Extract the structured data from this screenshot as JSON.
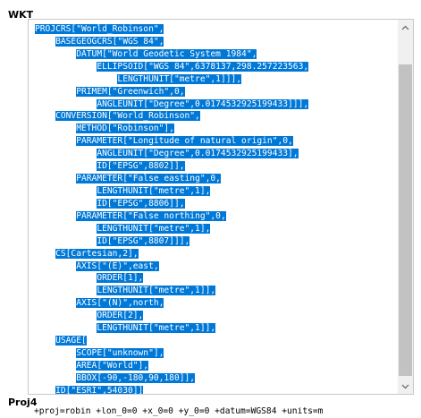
{
  "sections": {
    "wkt_label": "WKT",
    "proj4_label": "Proj4"
  },
  "wkt": {
    "lines": [
      {
        "indent": "",
        "text": "PROJCRS[\"World_Robinson\","
      },
      {
        "indent": "    ",
        "text": "BASEGEOGCRS[\"WGS 84\","
      },
      {
        "indent": "        ",
        "text": "DATUM[\"World Geodetic System 1984\","
      },
      {
        "indent": "            ",
        "text": "ELLIPSOID[\"WGS 84\",6378137,298.257223563,"
      },
      {
        "indent": "                ",
        "text": "LENGTHUNIT[\"metre\",1]]],"
      },
      {
        "indent": "        ",
        "text": "PRIMEM[\"Greenwich\",0,"
      },
      {
        "indent": "            ",
        "text": "ANGLEUNIT[\"Degree\",0.0174532925199433]]],"
      },
      {
        "indent": "    ",
        "text": "CONVERSION[\"World_Robinson\","
      },
      {
        "indent": "        ",
        "text": "METHOD[\"Robinson\"],"
      },
      {
        "indent": "        ",
        "text": "PARAMETER[\"Longitude of natural origin\",0,"
      },
      {
        "indent": "            ",
        "text": "ANGLEUNIT[\"Degree\",0.0174532925199433],"
      },
      {
        "indent": "            ",
        "text": "ID[\"EPSG\",8802]],"
      },
      {
        "indent": "        ",
        "text": "PARAMETER[\"False easting\",0,"
      },
      {
        "indent": "            ",
        "text": "LENGTHUNIT[\"metre\",1],"
      },
      {
        "indent": "            ",
        "text": "ID[\"EPSG\",8806]],"
      },
      {
        "indent": "        ",
        "text": "PARAMETER[\"False northing\",0,"
      },
      {
        "indent": "            ",
        "text": "LENGTHUNIT[\"metre\",1],"
      },
      {
        "indent": "            ",
        "text": "ID[\"EPSG\",8807]]],"
      },
      {
        "indent": "    ",
        "text": "CS[Cartesian,2],"
      },
      {
        "indent": "        ",
        "text": "AXIS[\"(E)\",east,"
      },
      {
        "indent": "            ",
        "text": "ORDER[1],"
      },
      {
        "indent": "            ",
        "text": "LENGTHUNIT[\"metre\",1]],"
      },
      {
        "indent": "        ",
        "text": "AXIS[\"(N)\",north,"
      },
      {
        "indent": "            ",
        "text": "ORDER[2],"
      },
      {
        "indent": "            ",
        "text": "LENGTHUNIT[\"metre\",1]],"
      },
      {
        "indent": "    ",
        "text": "USAGE["
      },
      {
        "indent": "        ",
        "text": "SCOPE[\"unknown\"],"
      },
      {
        "indent": "        ",
        "text": "AREA[\"World\"],"
      },
      {
        "indent": "        ",
        "text": "BBOX[-90,-180,90,180]],"
      },
      {
        "indent": "    ",
        "text": "ID[\"ESRI\",54030]]"
      }
    ]
  },
  "proj4": {
    "text": "+proj=robin +lon_0=0 +x_0=0 +y_0=0 +datum=WGS84 +units=m"
  },
  "colors": {
    "selection": "#0078d7",
    "scroll_thumb": "#c2c2c2",
    "scroll_track": "#f0f0f0"
  },
  "icons": {
    "scroll_up": "chevron-up-icon",
    "scroll_down": "chevron-down-icon"
  }
}
